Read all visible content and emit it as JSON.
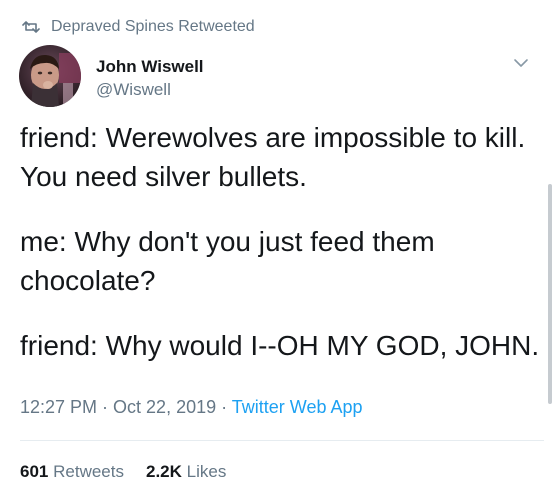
{
  "retweet_context": {
    "text": "Depraved Spines Retweeted",
    "icon": "retweet-icon"
  },
  "author": {
    "name": "John Wiswell",
    "handle": "@Wiswell",
    "avatar_icon": "avatar"
  },
  "menu": {
    "icon": "chevron-down-icon"
  },
  "tweet": {
    "paragraphs": [
      "friend: Werewolves are impossible to kill. You need silver bullets.",
      "me: Why don't you just feed them chocolate?",
      "friend: Why would I--OH MY GOD, JOHN."
    ]
  },
  "meta": {
    "time": "12:27 PM",
    "separator1": " · ",
    "date": "Oct 22, 2019",
    "separator2": " · ",
    "source": "Twitter Web App"
  },
  "stats": {
    "retweets_count": "601",
    "retweets_label": "Retweets",
    "likes_count": "2.2K",
    "likes_label": "Likes"
  },
  "colors": {
    "text": "#14171a",
    "secondary": "#657786",
    "link": "#1da1f2",
    "divider": "#e6ecf0"
  }
}
